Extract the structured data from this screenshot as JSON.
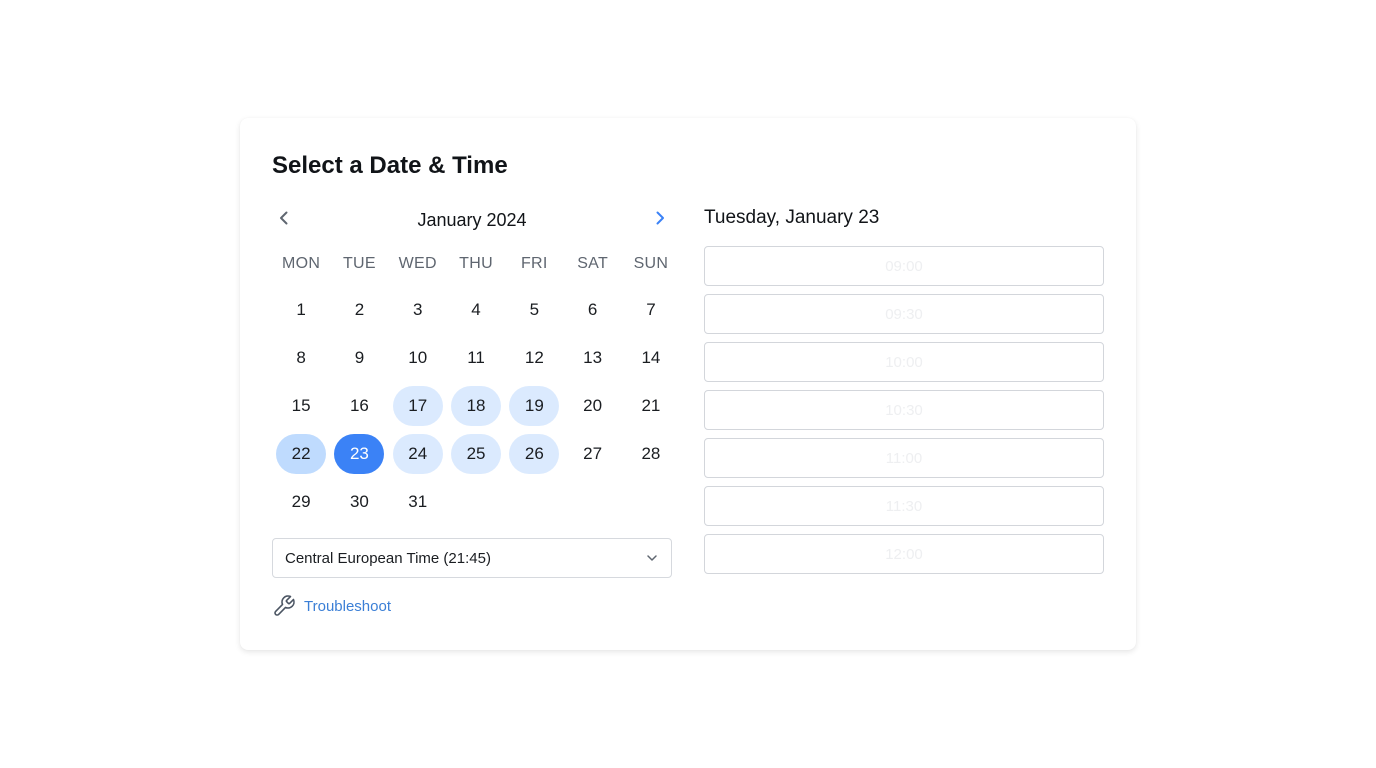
{
  "title": "Select a Date & Time",
  "calendar": {
    "month_label": "January 2024",
    "weekdays": [
      "MON",
      "TUE",
      "WED",
      "THU",
      "FRI",
      "SAT",
      "SUN"
    ],
    "days": [
      "1",
      "2",
      "3",
      "4",
      "5",
      "6",
      "7",
      "8",
      "9",
      "10",
      "11",
      "12",
      "13",
      "14",
      "15",
      "16",
      "17",
      "18",
      "19",
      "20",
      "21",
      "22",
      "23",
      "24",
      "25",
      "26",
      "27",
      "28",
      "29",
      "30",
      "31"
    ],
    "available_days": [
      "17",
      "18",
      "19",
      "22",
      "24",
      "25",
      "26"
    ],
    "emphasized_days": [
      "22"
    ],
    "selected_day": "23",
    "prev_icon": "chevron-left-icon",
    "next_icon": "chevron-right-icon"
  },
  "timezone": {
    "value": "Central European Time (21:45)",
    "icon": "chevron-down-icon"
  },
  "troubleshoot": {
    "label": "Troubleshoot",
    "icon": "wrench-icon"
  },
  "times": {
    "heading": "Tuesday, January 23",
    "slots": [
      "09:00",
      "09:30",
      "10:00",
      "10:30",
      "11:00",
      "11:30",
      "12:00"
    ]
  },
  "colors": {
    "accent": "#3b82f6",
    "available_bg": "#dbeafe",
    "link": "#3b7fd6"
  }
}
